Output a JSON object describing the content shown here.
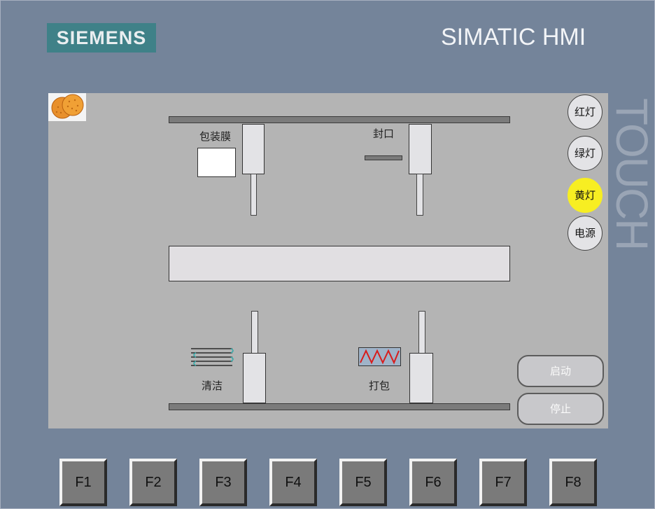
{
  "header": {
    "logo": "SIEMENS",
    "brand": "SIMATIC HMI",
    "touch": "TOUCH"
  },
  "screen": {
    "labels": {
      "film": "包装膜",
      "seal": "封口",
      "clean": "清洁",
      "pack": "打包"
    },
    "lamps": [
      {
        "label": "红灯",
        "state": "off"
      },
      {
        "label": "绿灯",
        "state": "off"
      },
      {
        "label": "黄灯",
        "state": "on"
      },
      {
        "label": "电源",
        "state": "off"
      }
    ],
    "buttons": {
      "start": "启动",
      "stop": "停止"
    }
  },
  "fkeys": [
    "F1",
    "F2",
    "F3",
    "F4",
    "F5",
    "F6",
    "F7",
    "F8"
  ],
  "colors": {
    "lamp_on": "#f7ee22",
    "bezel": "#74849a",
    "screen": "#b4b4b4",
    "logo": "#3f8188",
    "heater_wire": "#d81c1c",
    "coil": "#39a9a9"
  },
  "icons": {
    "product": "cookie-icon",
    "cleaner": "coil-icon",
    "heater": "heater-zigzag-icon"
  }
}
